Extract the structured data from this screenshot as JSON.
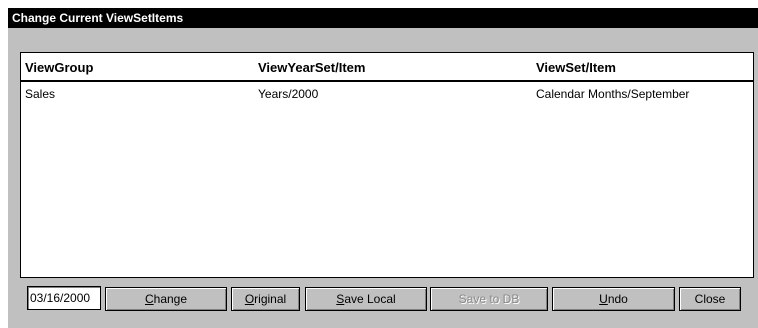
{
  "window": {
    "title": "Change Current ViewSetItems"
  },
  "list": {
    "columns": [
      "ViewGroup",
      "ViewYearSet/Item",
      "ViewSet/Item"
    ],
    "rows": [
      [
        "Sales",
        "Years/2000",
        "Calendar Months/September"
      ]
    ]
  },
  "toolbar": {
    "date_value": "03/16/2000",
    "change": {
      "mnemonic": "C",
      "rest": "hange"
    },
    "original": {
      "mnemonic": "O",
      "rest": "riginal"
    },
    "save_local": {
      "mnemonic": "S",
      "rest": "ave Local"
    },
    "save_to_db": "Save to DB",
    "undo": {
      "mnemonic": "U",
      "rest": "ndo"
    },
    "close": "Close"
  },
  "colors": {
    "title_background": "#000000",
    "window_face": "#c0c0c0",
    "disabled_text": "#8a8a8a"
  }
}
